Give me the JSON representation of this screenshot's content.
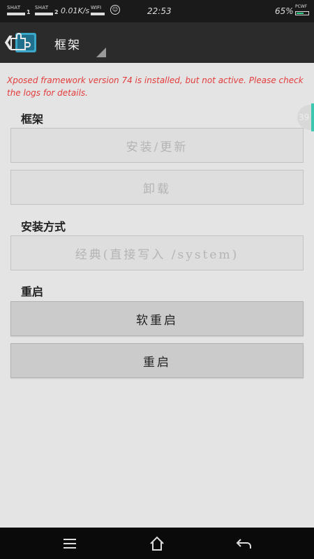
{
  "status_bar": {
    "sim1_label": "SHAT",
    "sim1_num": "1",
    "sim2_label": "SHAT",
    "sim2_num": "2",
    "net_speed": "0.01K/s",
    "wifi_label": "WIFI",
    "smile_glyph": "☺",
    "time": "22:53",
    "battery_pct": "65%",
    "battery_label": "PCWF",
    "battery_level": 0.65,
    "battery_color": "#2fd38a"
  },
  "action_bar": {
    "back_glyph": "❮",
    "app_icon": "xposed-puzzle-icon",
    "title": "框架",
    "background": "#2b2b2b"
  },
  "warning": {
    "text": "Xposed framework version 74 is installed, but not active. Please check the logs for details.",
    "color": "#e33b3b"
  },
  "scroll_badge": "39",
  "sections": {
    "framework": {
      "title": "框架",
      "install_label": "安装/更新",
      "uninstall_label": "卸载"
    },
    "install_method": {
      "title": "安装方式",
      "value": "经典(直接写入 /system)"
    },
    "reboot": {
      "title": "重启",
      "soft_reboot_label": "软重启",
      "reboot_label": "重启"
    }
  },
  "nav_bar": {
    "menu_icon": "menu-icon",
    "home_icon": "home-icon",
    "back_icon": "back-arrow-icon"
  }
}
